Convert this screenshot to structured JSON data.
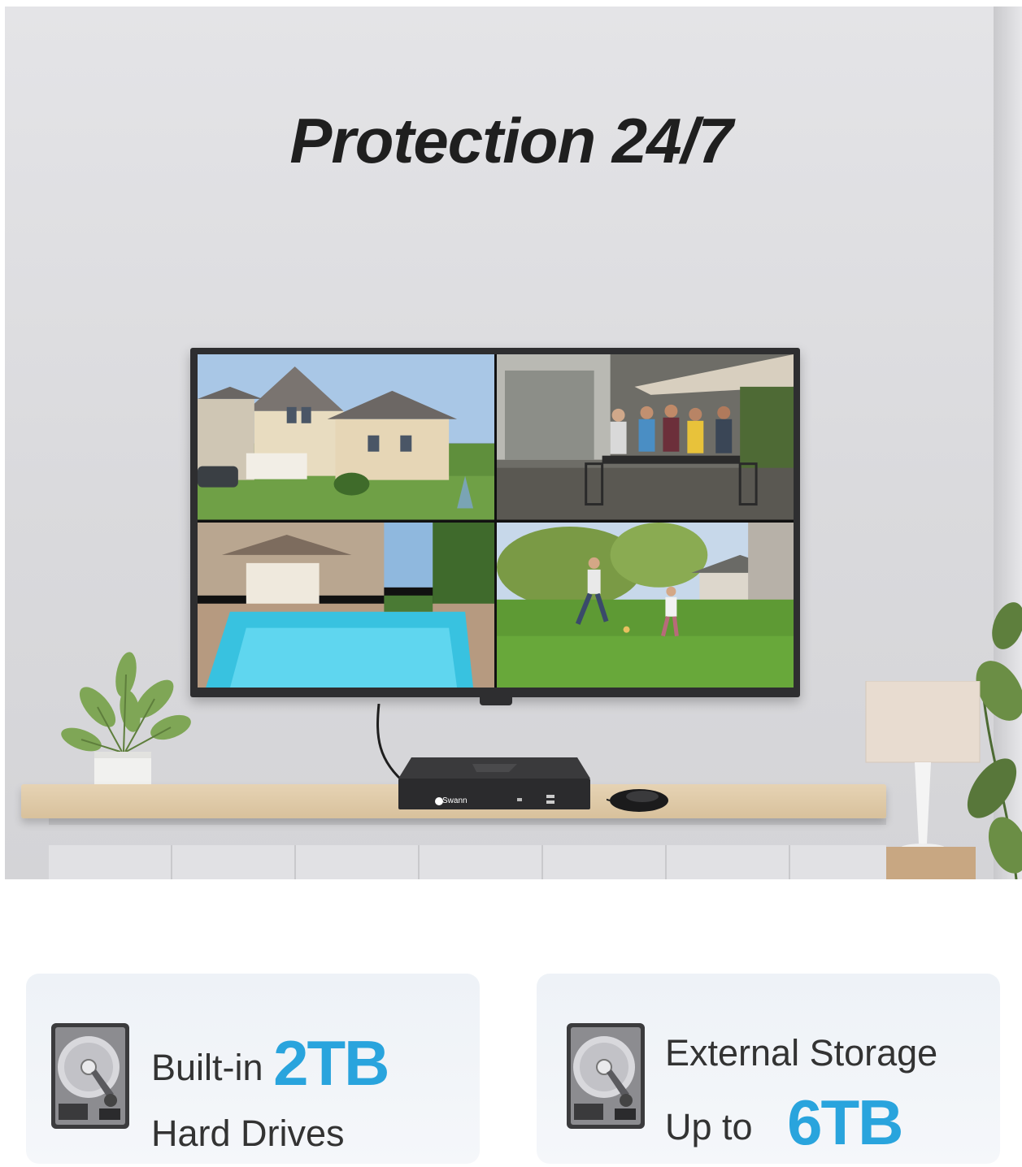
{
  "headline": "Protection 24/7",
  "nvr_brand": "Swann",
  "features": [
    {
      "line1_prefix": "Built-in",
      "line1_accent": "2TB",
      "line2": "Hard Drives"
    },
    {
      "line1": "External Storage",
      "line2_prefix": "Up to",
      "line2_accent": "6TB"
    }
  ],
  "colors": {
    "accent": "#29a4dd",
    "headline": "#1f1f1f",
    "card_bg": "#eef2f7"
  },
  "icons": [
    "hard-drive-icon",
    "hard-drive-icon"
  ]
}
